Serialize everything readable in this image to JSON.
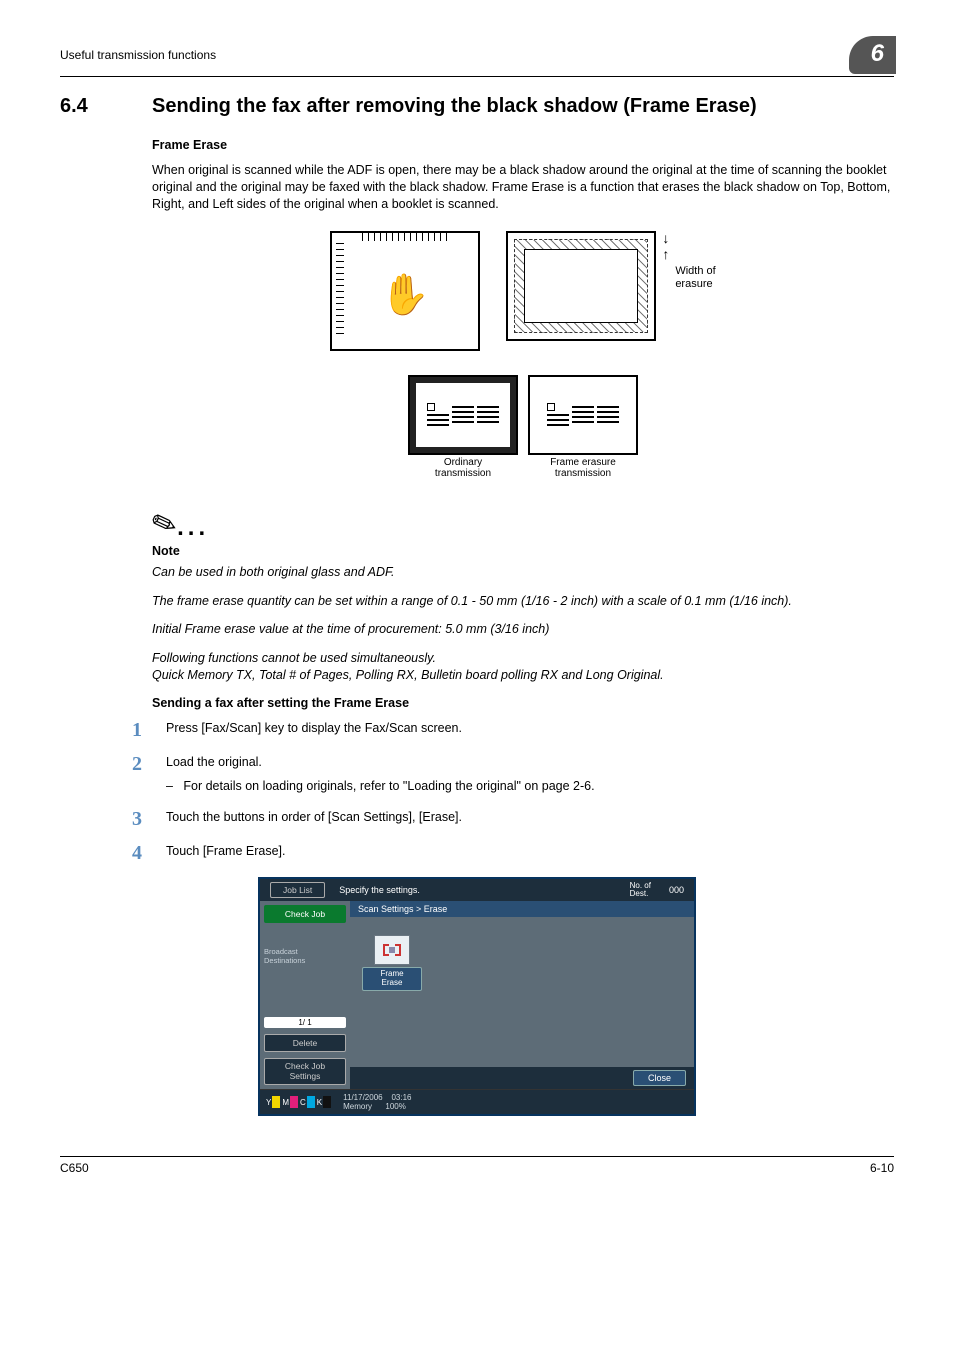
{
  "header": {
    "left": "Useful transmission functions",
    "chapter": "6"
  },
  "section": {
    "number": "6.4",
    "title": "Sending the fax after removing the black shadow (Frame Erase)"
  },
  "frame_erase": {
    "heading": "Frame Erase",
    "intro": "When original is scanned while the ADF is open, there may be a black shadow around the original at the time of scanning the booklet original and the original may be faxed with the black shadow. Frame Erase is a function that erases the black shadow on Top, Bottom, Right, and Left sides of the original when a booklet is scanned."
  },
  "diagram": {
    "width_label_l1": "Width of",
    "width_label_l2": "erasure",
    "caption_left_l1": "Ordinary",
    "caption_left_l2": "transmission",
    "caption_right_l1": "Frame erasure",
    "caption_right_l2": "transmission"
  },
  "note": {
    "heading": "Note",
    "p1": "Can be used in both original glass and ADF.",
    "p2": "The frame erase quantity can be set within a range of 0.1 - 50 mm (1/16 - 2 inch) with a scale of 0.1 mm (1/16 inch).",
    "p3": "Initial Frame erase value at the time of procurement: 5.0 mm (3/16 inch)",
    "p4": "Following functions cannot be used simultaneously.",
    "p5": "Quick Memory TX, Total # of Pages, Polling RX, Bulletin board polling RX and Long Original."
  },
  "procedure": {
    "heading": "Sending a fax after setting the Frame Erase",
    "s1": "Press [Fax/Scan] key to display the Fax/Scan screen.",
    "s2": "Load the original.",
    "s2_sub": "For details on loading originals, refer to \"Loading the original\" on page 2-6.",
    "s3": "Touch the buttons in order of [Scan Settings], [Erase].",
    "s4": "Touch [Frame Erase]."
  },
  "screen": {
    "top_instruction": "Specify the settings.",
    "dest_label": "No. of\nDest.",
    "dest_count": "000",
    "side": {
      "job_list": "Job List",
      "check_job": "Check Job",
      "broadcast": "Broadcast\nDestinations",
      "page": "1/   1",
      "delete": "Delete",
      "check_settings": "Check Job\nSettings"
    },
    "crumb": "Scan Settings > Erase",
    "frame_btn": "Frame\nErase",
    "close": "Close",
    "footer": {
      "date": "11/17/2006",
      "time": "03:16",
      "mem_label": "Memory",
      "mem_val": "100%"
    }
  },
  "footer": {
    "left": "C650",
    "right": "6-10"
  }
}
